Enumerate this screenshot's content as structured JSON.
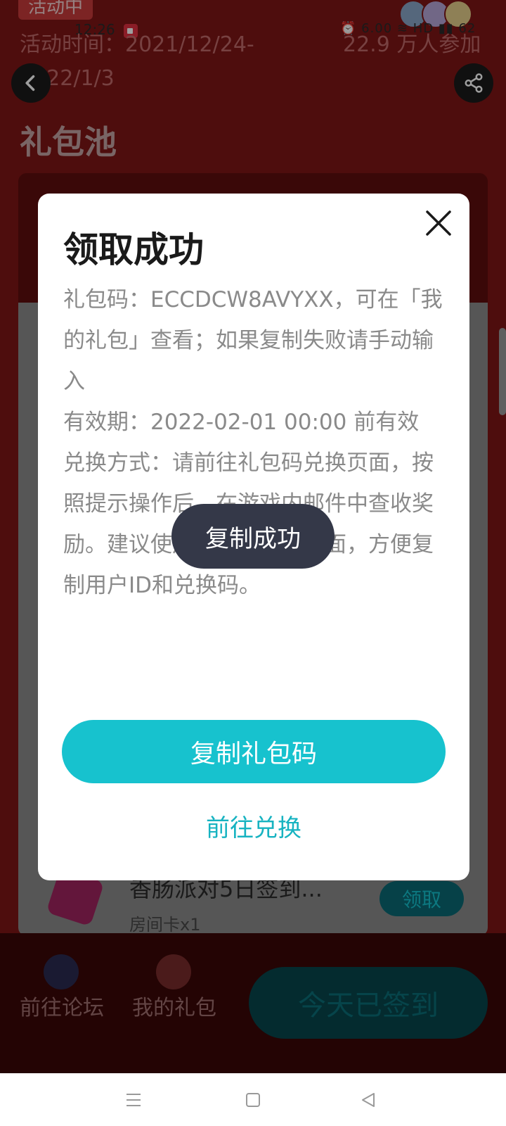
{
  "status_bar": {
    "time": "12:26",
    "right_text": "⏰ 6.00 ≋ HD ▮▮ 62"
  },
  "activity": {
    "badge": "活动中",
    "time_text": "活动时间：2021/12/24-2022/1/3",
    "participants": "22.9 万人参加"
  },
  "page": {
    "pool_title": "礼包池"
  },
  "gift_item": {
    "title": "香肠派对5日签到...",
    "subtitle": "房间卡x1",
    "claim_label": "领取"
  },
  "bottom_nav": {
    "forum_label": "前往论坛",
    "gifts_label": "我的礼包",
    "signed_label": "今天已签到"
  },
  "modal": {
    "title": "领取成功",
    "code_line": "礼包码：ECCDCW8AVYXX，可在「我的礼包」查看；如果复制失败请手动输入",
    "validity_line": "有效期：2022-02-01 00:00 前有效",
    "method_line": "兑换方式：请前往礼包码兑换页面，按照提示操作后，在游戏内邮件中查收奖励。建议使用浏览器打开页面，方便复制用户ID和兑换码。",
    "copy_button": "复制礼包码",
    "exchange_link": "前往兑换"
  },
  "toast": {
    "text": "复制成功"
  },
  "colors": {
    "accent": "#17c2ce",
    "page_bg": "#7e1616",
    "toast_bg": "#343848"
  }
}
